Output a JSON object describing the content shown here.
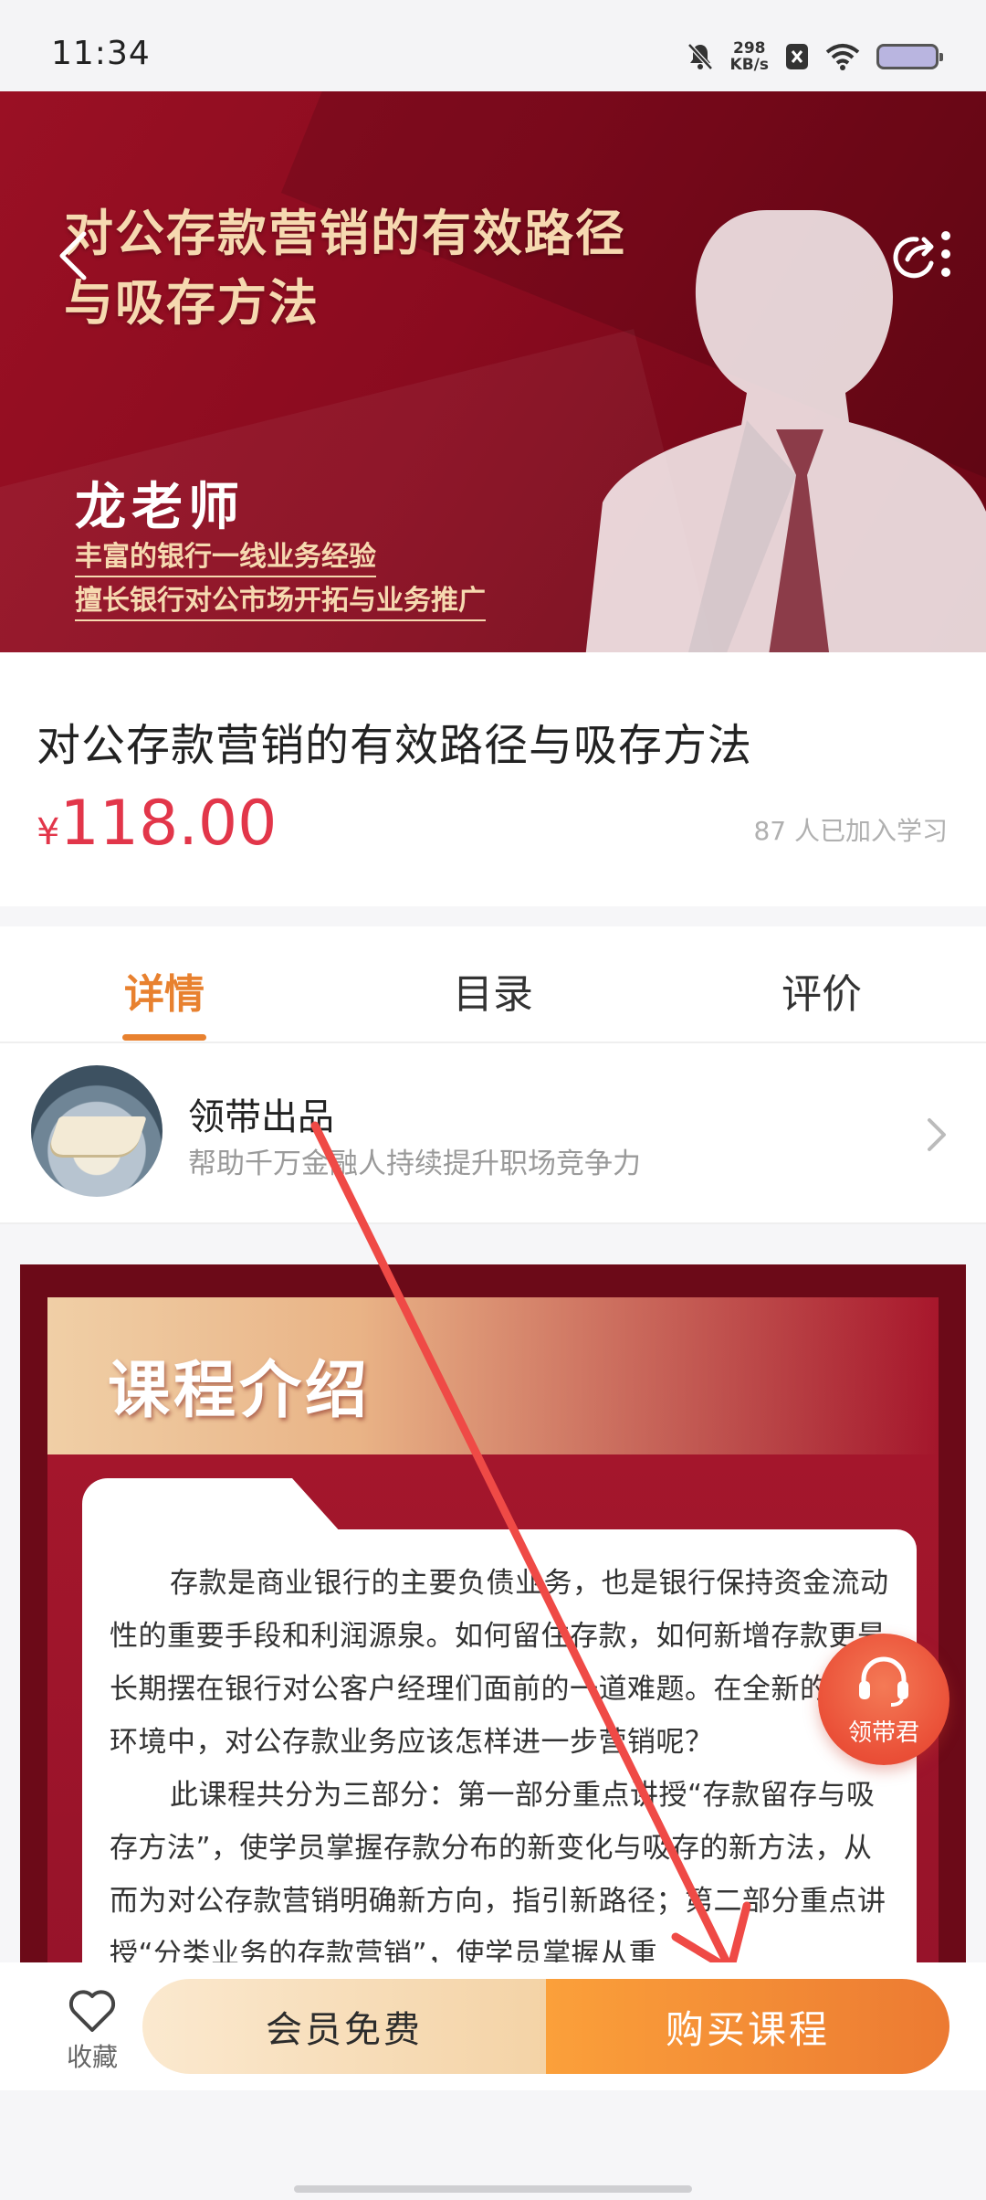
{
  "status_bar": {
    "time": "11:34",
    "net_speed_value": "298",
    "net_speed_unit": "KB/s"
  },
  "hero": {
    "title_line1": "对公存款营销的有效路径",
    "title_line2": "与吸存方法",
    "teacher": "龙老师",
    "feature1": "丰富的银行一线业务经验",
    "feature2": "擅长银行对公市场开拓与业务推广"
  },
  "course": {
    "title": "对公存款营销的有效路径与吸存方法",
    "currency": "¥",
    "price": "118.00",
    "learners": "87 人已加入学习"
  },
  "tabs": [
    {
      "label": "详情"
    },
    {
      "label": "目录"
    },
    {
      "label": "评价"
    }
  ],
  "publisher": {
    "name": "领带出品",
    "desc": "帮助千万金融人持续提升职场竞争力"
  },
  "intro": {
    "heading": "课程介绍",
    "paragraph1": "存款是商业银行的主要负债业务，也是银行保持资金流动性的重要手段和利润源泉。如何留住存款，如何新增存款更是长期摆在银行对公客户经理们面前的一道难题。在全新的市场环境中，对公存款业务应该怎样进一步营销呢？",
    "paragraph2": "此课程共分为三部分：第一部分重点讲授“存款留存与吸存方法”，使学员掌握存款分布的新变化与吸存的新方法，从而为对公存款营销明确新方向，指引新路径；第二部分重点讲授“分类业务的存款营销”，使学员掌握从重"
  },
  "assistant": {
    "label": "领带君"
  },
  "bottom_bar": {
    "favorite_label": "收藏",
    "member_label": "会员免费",
    "buy_label": "购买课程"
  },
  "colors": {
    "accent": "#e8812f",
    "price": "#e2364a",
    "hero_red": "#9a1024",
    "buy_orange": "#ec7a32"
  }
}
